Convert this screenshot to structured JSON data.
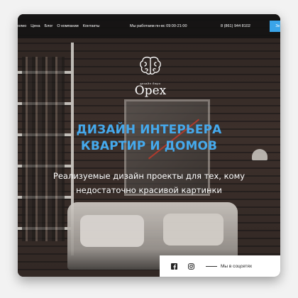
{
  "header": {
    "nav_items": [
      "олио",
      "Цена",
      "Блог",
      "О компании",
      "Контакты"
    ],
    "hours": "Мы работаем пн-вс 09:00-21:00",
    "phone": "8 (861) 944 8102",
    "cta_label": "Зв"
  },
  "logo": {
    "small_text": "дизайн бюро",
    "name": "Орех"
  },
  "hero": {
    "title_line1": "ДИЗАЙН ИНТЕРЬЕРА",
    "title_line2": "КВАРТИР И ДОМОВ",
    "subtitle_line1": "Реализуемые дизайн проекты для тех, кому",
    "subtitle_line2": "недостаточно красивой картинки"
  },
  "social": {
    "label": "Мы в соцсетях",
    "icons": [
      "facebook-icon",
      "instagram-icon"
    ]
  },
  "colors": {
    "accent": "#45a9ec",
    "cta": "#3aa4e8",
    "topbar": "#121212"
  }
}
